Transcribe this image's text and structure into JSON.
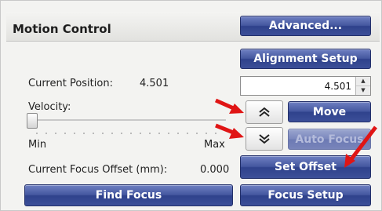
{
  "panel": {
    "title": "Motion Control"
  },
  "buttons": {
    "advanced": "Advanced...",
    "alignment_setup": "Alignment Setup",
    "move": "Move",
    "auto_focus": "Auto Focus",
    "set_offset": "Set Offset",
    "find_focus": "Find Focus",
    "focus_setup": "Focus Setup"
  },
  "position": {
    "label": "Current Position:",
    "value": "4.501",
    "input_value": "4.501"
  },
  "velocity": {
    "label": "Velocity:",
    "min_label": "Min",
    "max_label": "Max",
    "level": 0.0
  },
  "focus_offset": {
    "label": "Current Focus Offset (mm):",
    "value": "0.000"
  },
  "icons": {
    "step_up": "double-chevron-up-icon",
    "step_down": "double-chevron-down-icon",
    "annotation": "red-arrow-icon"
  },
  "colors": {
    "button_blue": "#3c4f98",
    "annotation_red": "#e01515"
  }
}
